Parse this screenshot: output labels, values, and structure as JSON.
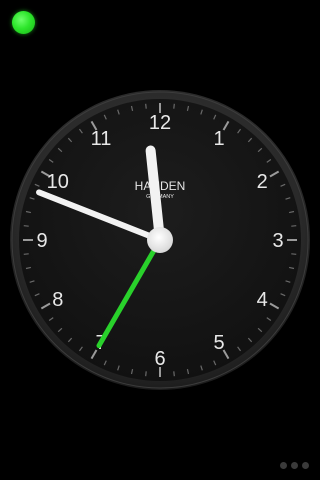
{
  "status_light": {
    "color": "#2ee62c",
    "icon": "green-status-light"
  },
  "clock": {
    "brand": "HANDEN",
    "subbrand": "GERMANY",
    "numerals": [
      "12",
      "1",
      "2",
      "3",
      "4",
      "5",
      "6",
      "7",
      "8",
      "9",
      "10",
      "11"
    ],
    "time": {
      "hours": 11,
      "minutes": 48,
      "seconds": 35
    },
    "colors": {
      "face": "#151515",
      "bezel": "#2b2b2b",
      "hands": "#f2f2f2",
      "second_hand": "#29d12b"
    }
  },
  "page_indicator": {
    "pages": 3
  }
}
